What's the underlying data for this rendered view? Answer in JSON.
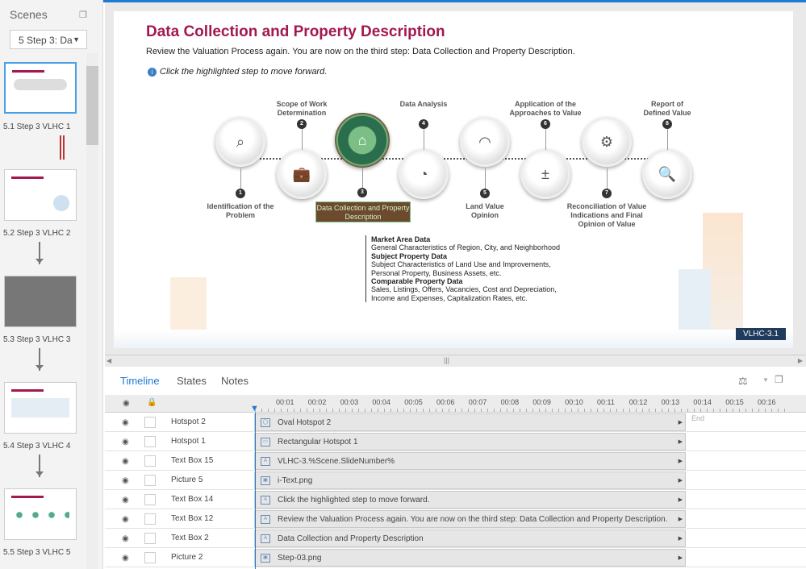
{
  "scenes": {
    "title": "Scenes",
    "dropdown": "5 Step 3: Da",
    "items": [
      {
        "label": "5.1 Step 3 VLHC 1"
      },
      {
        "label": "5.2 Step 3 VLHC 2"
      },
      {
        "label": "5.3 Step 3 VLHC 3"
      },
      {
        "label": "5.4 Step 3 VLHC 4"
      },
      {
        "label": "5.5 Step 3 VLHC 5"
      }
    ]
  },
  "slide": {
    "title": "Data Collection and Property Description",
    "subtitle": "Review the Valuation Process again. You are now on the third step: Data Collection and Property Description.",
    "hint": "Click the highlighted step to move forward.",
    "steps": [
      {
        "n": "1",
        "label": "Identification of the Problem"
      },
      {
        "n": "2",
        "label": "Scope of Work Determination"
      },
      {
        "n": "3",
        "label": "Data Collection and Property Description"
      },
      {
        "n": "4",
        "label": "Data Analysis"
      },
      {
        "n": "5",
        "label": "Land Value Opinion"
      },
      {
        "n": "6",
        "label": "Application of the Approaches to Value"
      },
      {
        "n": "7",
        "label": "Reconciliation of Value Indications and Final Opinion of Value"
      },
      {
        "n": "8",
        "label": "Report of Defined Value"
      }
    ],
    "details": [
      "Market Area Data",
      "General Characteristics of Region, City, and Neighborhood",
      "Subject Property Data",
      "Subject Characteristics of Land Use and Improvements, Personal Property, Business Assets, etc.",
      "Comparable Property Data",
      "Sales, Listings, Offers, Vacancies, Cost and Depreciation, Income and Expenses, Capitalization Rates, etc."
    ],
    "slide_number": "VLHC-3.1"
  },
  "timeline": {
    "tabs": [
      "Timeline",
      "States",
      "Notes"
    ],
    "ticks": [
      "00:01",
      "00:02",
      "00:03",
      "00:04",
      "00:05",
      "00:06",
      "00:07",
      "00:08",
      "00:09",
      "00:10",
      "00:11",
      "00:12",
      "00:13",
      "00:14",
      "00:15",
      "00:16"
    ],
    "end_label": "End",
    "rows": [
      {
        "name": "Hotspot 2",
        "item": "Oval Hotspot 2"
      },
      {
        "name": "Hotspot 1",
        "item": "Rectangular Hotspot 1"
      },
      {
        "name": "Text Box 15",
        "item": "VLHC-3.%Scene.SlideNumber%"
      },
      {
        "name": "Picture 5",
        "item": "i-Text.png"
      },
      {
        "name": "Text Box 14",
        "item": "Click the highlighted step to move forward."
      },
      {
        "name": "Text Box 12",
        "item": "Review the Valuation Process again. You are now on the third step: Data Collection and Property Description."
      },
      {
        "name": "Text Box 2",
        "item": "Data Collection and Property Description"
      },
      {
        "name": "Picture 2",
        "item": "Step-03.png"
      }
    ]
  }
}
